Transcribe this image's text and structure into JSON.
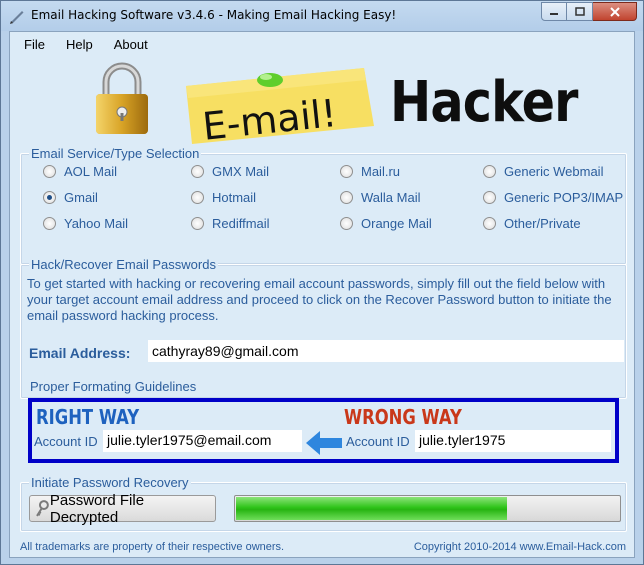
{
  "window": {
    "title": "Email Hacking Software v3.4.6 - Making Email Hacking Easy!"
  },
  "menu": [
    "File",
    "Help",
    "About"
  ],
  "header": {
    "note_text": "E-mail!",
    "brand": "Hacker"
  },
  "service": {
    "title": "Email Service/Type Selection",
    "options": [
      "AOL Mail",
      "GMX Mail",
      "Mail.ru",
      "Generic Webmail",
      "Gmail",
      "Hotmail",
      "Walla Mail",
      "Generic POP3/IMAP",
      "Yahoo Mail",
      "Rediffmail",
      "Orange Mail",
      "Other/Private"
    ],
    "selected": "Gmail"
  },
  "hack": {
    "title": "Hack/Recover Email Passwords",
    "description": "To get started with hacking or recovering email account passwords, simply fill out the field below with your target account email address and proceed to click on the Recover Password button to initiate the email password hacking process.",
    "email_label": "Email Address:",
    "email_value": "cathyray89@gmail.com"
  },
  "format": {
    "title": "Proper Formating Guidelines",
    "right_heading": "RIGHT WAY",
    "wrong_heading": "WRONG WAY",
    "account_label": "Account ID",
    "right_example": "julie.tyler1975@email.com",
    "wrong_example": "julie.tyler1975",
    "right_color": "#1e62bf",
    "wrong_color": "#c9381a"
  },
  "recover": {
    "title": "Initiate Password Recovery",
    "button_label": "Password File Decrypted",
    "button_icon": "key-icon",
    "progress": 0.71
  },
  "footer": {
    "left": "All trademarks are property of their respective owners.",
    "right": "Copyright 2010-2014  www.Email-Hack.com"
  }
}
